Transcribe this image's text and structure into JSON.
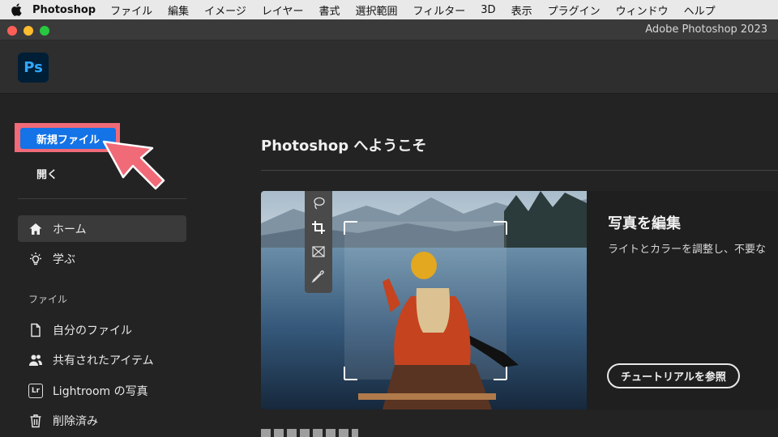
{
  "menubar": {
    "app_name": "Photoshop",
    "items": [
      "ファイル",
      "編集",
      "イメージ",
      "レイヤー",
      "書式",
      "選択範囲",
      "フィルター",
      "3D",
      "表示",
      "プラグイン",
      "ウィンドウ",
      "ヘルプ"
    ]
  },
  "window": {
    "title": "Adobe Photoshop 2023"
  },
  "logo": {
    "text": "Ps"
  },
  "sidebar": {
    "new_file_label": "新規ファイル",
    "open_label": "開く",
    "nav": [
      {
        "label": "ホーム",
        "icon": "home-icon",
        "active": true
      },
      {
        "label": "学ぶ",
        "icon": "lightbulb-icon",
        "active": false
      }
    ],
    "file_section_label": "ファイル",
    "file_items": [
      {
        "label": "自分のファイル",
        "icon": "file-icon"
      },
      {
        "label": "共有されたアイテム",
        "icon": "shared-users-icon"
      },
      {
        "label": "Lightroom の写真",
        "icon": "lightroom-icon",
        "badge": "Lr"
      },
      {
        "label": "削除済み",
        "icon": "trash-icon"
      }
    ]
  },
  "main": {
    "welcome_title": "Photoshop へようこそ",
    "card": {
      "title": "写真を編集",
      "description": "ライトとカラーを調整し、不要な",
      "button_label": "チュートリアルを参照",
      "tools": [
        "lasso-icon",
        "crop-icon",
        "frame-icon",
        "eyedropper-icon"
      ]
    }
  },
  "colors": {
    "accent": "#1473e6",
    "highlight": "#f06a78",
    "background": "#232323"
  }
}
